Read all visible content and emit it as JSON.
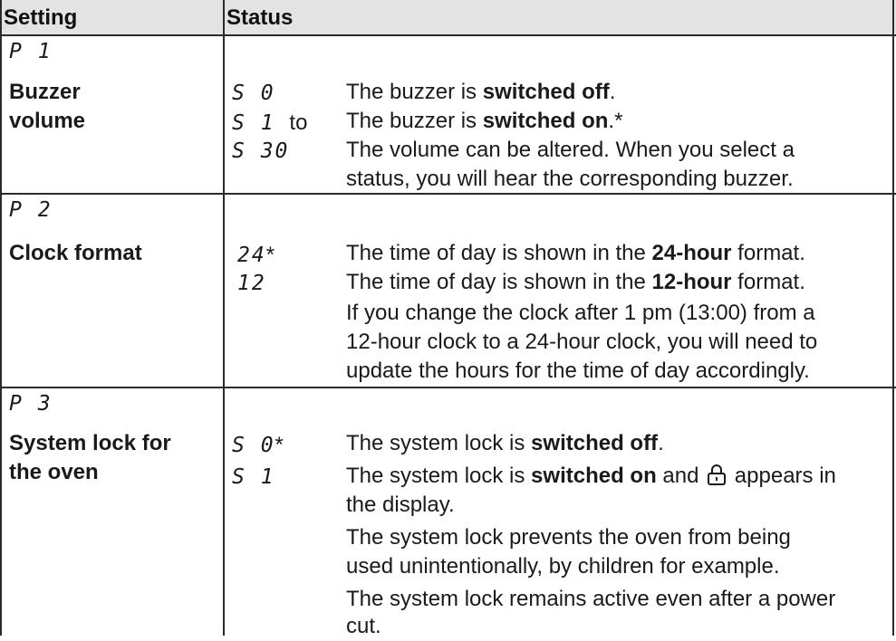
{
  "header": {
    "setting": "Setting",
    "status": "Status"
  },
  "rows": [
    {
      "code": "P 1",
      "name": [
        "Buzzer",
        "volume"
      ],
      "statuses": [
        {
          "code": "S 0",
          "lines": [
            [
              "The buzzer is ",
              "switched off",
              "."
            ]
          ]
        },
        {
          "code": "S 1",
          "suffix": "to",
          "lines": [
            [
              "The buzzer is ",
              "switched on",
              ".*"
            ]
          ]
        },
        {
          "code": "S 30",
          "lines": [
            [
              "The volume can be altered. When you select a",
              "",
              ""
            ],
            [
              "status, you will hear the corresponding buzzer.",
              "",
              ""
            ]
          ]
        }
      ]
    },
    {
      "code": "P 2",
      "name": [
        "Clock format"
      ],
      "statuses": [
        {
          "code": "24",
          "suffix": "*",
          "lines": [
            [
              "The time of day is shown in the ",
              "24-hour",
              " format."
            ]
          ]
        },
        {
          "code": "12",
          "lines": [
            [
              "The time of day is shown in the ",
              "12-hour",
              " format."
            ],
            [
              "If you change the clock after 1 pm (13:00) from a",
              "",
              ""
            ],
            [
              "12-hour clock to a 24-hour clock, you will need to",
              "",
              ""
            ],
            [
              "update the hours for the time of day accordingly.",
              "",
              ""
            ]
          ]
        }
      ]
    },
    {
      "code": "P 3",
      "name": [
        "System lock for",
        "the oven"
      ],
      "statuses": [
        {
          "code": "S 0",
          "suffix": "*",
          "lines": [
            [
              "The system lock is ",
              "switched off",
              "."
            ]
          ]
        },
        {
          "code": "S 1",
          "lines": [
            [
              "The system lock is ",
              "switched on",
              " and"
            ],
            [
              "the display.",
              "",
              ""
            ],
            [
              "The system lock prevents the oven from being",
              "",
              ""
            ],
            [
              "used unintentionally, by children for example.",
              "",
              ""
            ],
            [
              "The system lock remains active even after a power",
              "",
              ""
            ],
            [
              "cut.",
              "",
              ""
            ]
          ],
          "after_icon": "appears in"
        }
      ]
    }
  ],
  "icons": {
    "lock": "padlock-icon"
  },
  "colors": {
    "header_bg": "#e3e3e3",
    "rule": "#2b2b2b",
    "text": "#1a1a1a"
  }
}
